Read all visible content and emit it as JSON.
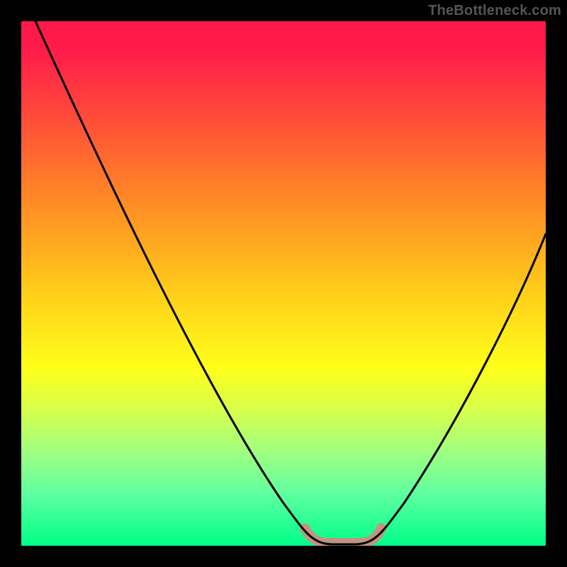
{
  "watermark": "TheBottleneck.com",
  "chart_data": {
    "type": "line",
    "title": "",
    "xlabel": "",
    "ylabel": "",
    "xlim": [
      0,
      100
    ],
    "ylim": [
      0,
      100
    ],
    "description": "V-shaped bottleneck curve over vertical red→yellow→green gradient; curve dips to baseline between x≈55 and x≈65 with a soft pink highlight at the trough, then rises again.",
    "series": [
      {
        "name": "bottleneck-curve",
        "x": [
          2,
          10,
          20,
          30,
          40,
          50,
          55,
          58,
          62,
          65,
          70,
          80,
          90,
          100
        ],
        "y": [
          100,
          82,
          63,
          46,
          29,
          12,
          3,
          0,
          0,
          3,
          12,
          30,
          46,
          62
        ]
      }
    ],
    "highlight": {
      "x_start": 54,
      "x_end": 66,
      "color": "#e18080",
      "note": "optimal-zone"
    },
    "gradient_stops": [
      {
        "pos": 0,
        "color": "#ff1a4a"
      },
      {
        "pos": 30,
        "color": "#ff7a2a"
      },
      {
        "pos": 54,
        "color": "#ffd61a"
      },
      {
        "pos": 66,
        "color": "#ffff1a"
      },
      {
        "pos": 82,
        "color": "#a0ff80"
      },
      {
        "pos": 100,
        "color": "#00ff88"
      }
    ]
  }
}
